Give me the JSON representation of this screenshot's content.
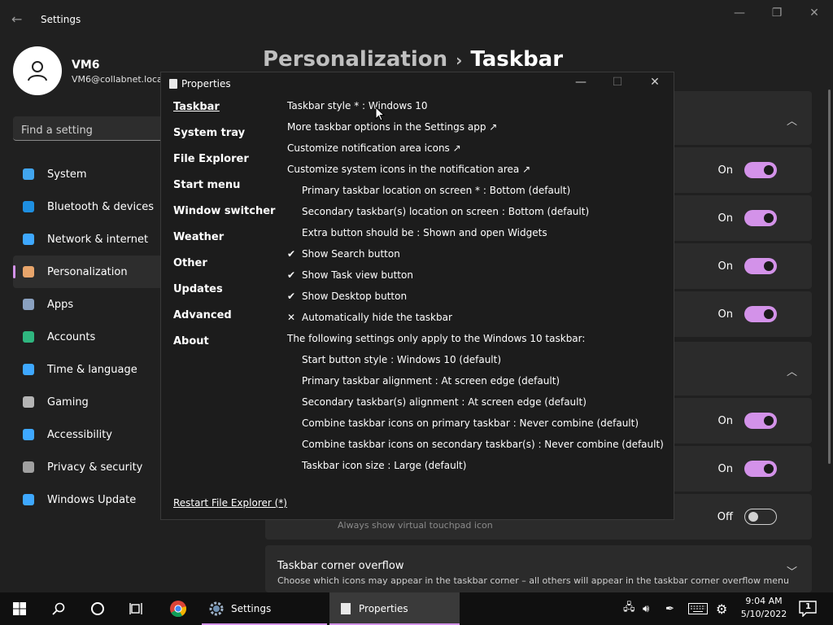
{
  "settings": {
    "title": "Settings",
    "user": {
      "name": "VM6",
      "email": "VM6@collabnet.loca"
    },
    "search_placeholder": "Find a setting",
    "nav": [
      {
        "label": "System",
        "icon": "monitor-icon",
        "color": "#41a5ee"
      },
      {
        "label": "Bluetooth & devices",
        "icon": "bluetooth-icon",
        "color": "#1e8fe1"
      },
      {
        "label": "Network & internet",
        "icon": "wifi-icon",
        "color": "#3ea8ff"
      },
      {
        "label": "Personalization",
        "icon": "brush-icon",
        "color": "#e8a56b",
        "active": true
      },
      {
        "label": "Apps",
        "icon": "apps-icon",
        "color": "#8aa1c0"
      },
      {
        "label": "Accounts",
        "icon": "person-icon",
        "color": "#2fb67f"
      },
      {
        "label": "Time & language",
        "icon": "clock-globe-icon",
        "color": "#3ea8ff"
      },
      {
        "label": "Gaming",
        "icon": "gamepad-icon",
        "color": "#b5b5b5"
      },
      {
        "label": "Accessibility",
        "icon": "accessibility-icon",
        "color": "#3ea8ff"
      },
      {
        "label": "Privacy & security",
        "icon": "shield-icon",
        "color": "#a0a0a0"
      },
      {
        "label": "Windows Update",
        "icon": "update-icon",
        "color": "#3ea8ff"
      }
    ],
    "breadcrumb": {
      "parent": "Personalization",
      "current": "Taskbar"
    },
    "toggles": [
      {
        "state": "On",
        "on": true
      },
      {
        "state": "On",
        "on": true
      },
      {
        "state": "On",
        "on": true
      },
      {
        "state": "On",
        "on": true
      },
      {
        "state": "On",
        "on": true
      },
      {
        "state": "On",
        "on": true
      },
      {
        "state": "Off",
        "on": false
      }
    ],
    "touchpad_hint": "Always show virtual touchpad icon",
    "overflow": {
      "title": "Taskbar corner overflow",
      "desc": "Choose which icons may appear in the taskbar corner – all others will appear in the taskbar corner overflow menu"
    }
  },
  "props": {
    "title": "Properties",
    "nav": [
      "Taskbar",
      "System tray",
      "File Explorer",
      "Start menu",
      "Window switcher",
      "Weather",
      "Other",
      "Updates",
      "Advanced",
      "About"
    ],
    "restart": "Restart File Explorer (*)",
    "options": [
      {
        "text": "Taskbar style * : Windows 10",
        "indent": false,
        "mark": ""
      },
      {
        "text": "More taskbar options in the Settings app ↗",
        "indent": false,
        "mark": ""
      },
      {
        "text": "Customize notification area icons ↗",
        "indent": false,
        "mark": ""
      },
      {
        "text": "Customize system icons in the notification area ↗",
        "indent": false,
        "mark": ""
      },
      {
        "text": "Primary taskbar location on screen * : Bottom (default)",
        "indent": true,
        "mark": ""
      },
      {
        "text": "Secondary taskbar(s) location on screen : Bottom (default)",
        "indent": true,
        "mark": ""
      },
      {
        "text": "Extra button should be : Shown and open Widgets",
        "indent": true,
        "mark": ""
      },
      {
        "text": "Show Search button",
        "indent": true,
        "mark": "✔"
      },
      {
        "text": "Show Task view button",
        "indent": true,
        "mark": "✔"
      },
      {
        "text": "Show Desktop button",
        "indent": true,
        "mark": "✔"
      },
      {
        "text": "Automatically hide the taskbar",
        "indent": true,
        "mark": "✕"
      },
      {
        "text": "The following settings only apply to the Windows 10 taskbar:",
        "indent": false,
        "mark": ""
      },
      {
        "text": "Start button style : Windows 10 (default)",
        "indent": true,
        "mark": ""
      },
      {
        "text": "Primary taskbar alignment : At screen edge (default)",
        "indent": true,
        "mark": ""
      },
      {
        "text": "Secondary taskbar(s) alignment : At screen edge (default)",
        "indent": true,
        "mark": ""
      },
      {
        "text": "Combine taskbar icons on primary taskbar : Never combine (default)",
        "indent": true,
        "mark": ""
      },
      {
        "text": "Combine taskbar icons on secondary taskbar(s) : Never combine (default)",
        "indent": true,
        "mark": ""
      },
      {
        "text": "Taskbar icon size : Large (default)",
        "indent": true,
        "mark": ""
      }
    ]
  },
  "taskbar": {
    "apps": [
      {
        "label": "Settings"
      },
      {
        "label": "Properties"
      }
    ],
    "time": "9:04 AM",
    "date": "5/10/2022",
    "notification_count": "1"
  },
  "colors": {
    "accent": "#d392e9"
  }
}
